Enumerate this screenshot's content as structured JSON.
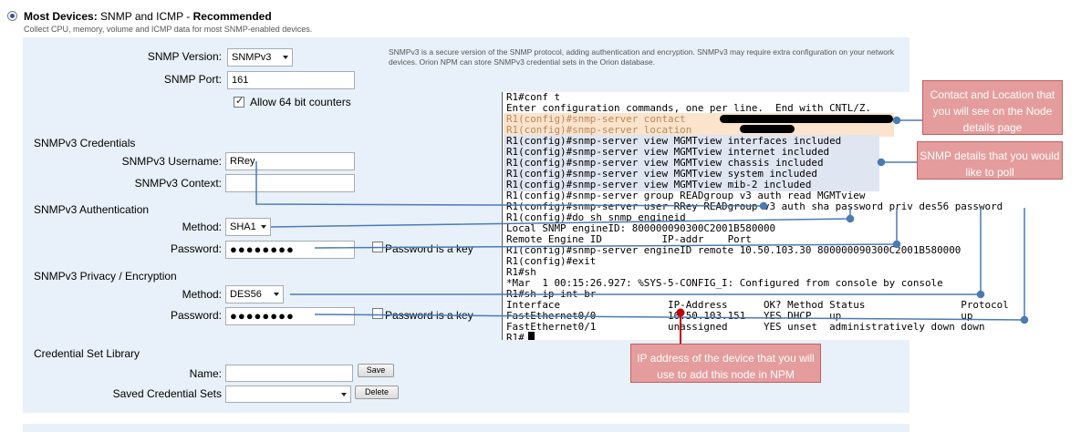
{
  "header": {
    "title_bold": "Most Devices:",
    "title_mid": " SNMP and ICMP - ",
    "title_rec": "Recommended",
    "subtitle": "Collect CPU, memory, volume and ICMP data for most SNMP-enabled devices."
  },
  "info_text": "SNMPv3 is a secure version of the SNMP protocol, adding authentication and encryption. SNMPv3 may require extra configuration on your network devices. Orion NPM can store SNMPv3 credential sets in the Orion database.",
  "form": {
    "snmp_version_label": "SNMP Version:",
    "snmp_version_value": "SNMPv3",
    "snmp_port_label": "SNMP Port:",
    "snmp_port_value": "161",
    "allow64_label": "Allow 64 bit counters",
    "allow64_checked": true,
    "credentials_section": "SNMPv3 Credentials",
    "username_label": "SNMPv3 Username:",
    "username_value": "RRey",
    "context_label": "SNMPv3 Context:",
    "context_value": "",
    "auth_section": "SNMPv3 Authentication",
    "auth_method_label": "Method:",
    "auth_method_value": "SHA1",
    "auth_password_label": "Password:",
    "auth_password_value": "●●●●●●●●",
    "auth_key_label": "Password is a key",
    "privacy_section": "SNMPv3 Privacy / Encryption",
    "priv_method_label": "Method:",
    "priv_method_value": "DES56",
    "priv_password_label": "Password:",
    "priv_password_value": "●●●●●●●●",
    "priv_key_label": "Password is a key",
    "library_section": "Credential Set Library",
    "name_label": "Name:",
    "name_value": "",
    "save_button": "Save",
    "saved_sets_label": "Saved Credential Sets",
    "saved_sets_value": "",
    "delete_button": "Delete"
  },
  "terminal": {
    "lines": [
      "R1#conf t",
      "Enter configuration commands, one per line.  End with CNTL/Z.",
      "R1(config)#snmp-server contact",
      "R1(config)#snmp-server location",
      "R1(config)#snmp-server view MGMTview interfaces included",
      "R1(config)#snmp-server view MGMTview internet included",
      "R1(config)#snmp-server view MGMTview chassis included",
      "R1(config)#snmp-server view MGMTview system included",
      "R1(config)#snmp-server view MGMTview mib-2 included",
      "R1(config)#snmp-server group READgroup v3 auth read MGMTview",
      "R1(config)#snmp-server user RRey READgroup v3 auth sha password priv des56 password",
      "R1(config)#do sh snmp engineid",
      "Local SNMP engineID: 800000090300C2001B580000",
      "Remote Engine ID          IP-addr    Port",
      "R1(config)#snmp-server engineID remote 10.50.103.30 800000090300C2001B580000",
      "R1(config)#exit",
      "R1#sh",
      "*Mar  1 00:15:26.927: %SYS-5-CONFIG_I: Configured from console by console",
      "R1#sh ip int br",
      "Interface                  IP-Address      OK? Method Status                Protocol",
      "FastEthernet0/0            10.50.103.151   YES DHCP   up                    up",
      "FastEthernet0/1            unassigned      YES unset  administratively down down",
      "R1#"
    ]
  },
  "callouts": {
    "contact_location": "Contact and Location that you will see on the Node details page",
    "snmp_details": "SNMP details that you would like to poll",
    "ip_address": "IP address of the device that you will use to add this node in NPM"
  },
  "colors": {
    "panel_bg": "#e8f1f9",
    "callout_bg": "#e59c9c",
    "connector_line": "#4a7ab5",
    "ip_line": "#c00000"
  }
}
